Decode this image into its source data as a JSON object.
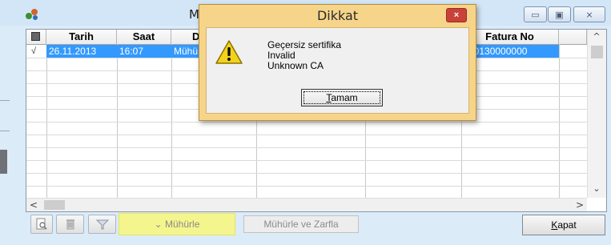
{
  "window": {
    "title": "M",
    "minimize_glyph": "▭",
    "maximize_glyph": "▣",
    "close_glyph": "⨯"
  },
  "grid": {
    "columns": [
      "Tarih",
      "Saat",
      "D",
      "",
      "",
      "Fatura No"
    ],
    "selected_row": {
      "check": "√",
      "tarih": "26.11.2013",
      "saat": "16:07",
      "d": "Mühü",
      "fatura_no": "S20130000000"
    },
    "scroll_up": "^",
    "scroll_down": "⌄",
    "scroll_left": "<",
    "scroll_right": ">"
  },
  "toolbar": {
    "seal_label": "Mühürle",
    "seal_icon_glyph": "⌄",
    "seal_envelope_label": "Mühürle ve Zarfla",
    "close_label_accel": "K",
    "close_label_rest": "apat"
  },
  "dialog": {
    "title": "Dikkat",
    "close_glyph": "×",
    "messages": [
      "Geçersiz sertifika",
      "Invalid",
      "Unknown CA"
    ],
    "ok_accel": "T",
    "ok_rest": "amam"
  },
  "colors": {
    "selection": "#3399ff",
    "dialog_frame": "#f6d48a",
    "seal_button_highlight": "#f5f58e"
  }
}
